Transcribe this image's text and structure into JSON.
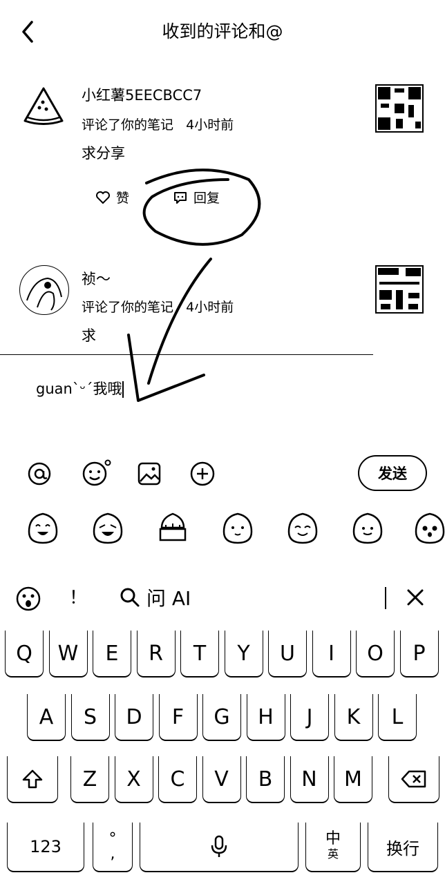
{
  "header": {
    "title": "收到的评论和@"
  },
  "comments": [
    {
      "name": "小红薯5EECBCC7",
      "action": "评论了你的笔记",
      "time": "4小时前",
      "text": "求分享",
      "like_label": "赞",
      "reply_label": "回复"
    },
    {
      "name": "祯～",
      "action": "评论了你的笔记",
      "time": "4小时前",
      "text": "求"
    }
  ],
  "input": {
    "value": "guanˋᵕˊ我哦"
  },
  "toolbar": {
    "send_label": "发送"
  },
  "suggestions": {
    "exclaim": "！",
    "ask_ai": "问 AI"
  },
  "keyboard": {
    "row1": [
      "Q",
      "W",
      "E",
      "R",
      "T",
      "Y",
      "U",
      "I",
      "O",
      "P"
    ],
    "row2": [
      "A",
      "S",
      "D",
      "F",
      "G",
      "H",
      "J",
      "K",
      "L"
    ],
    "row3": [
      "Z",
      "X",
      "C",
      "V",
      "B",
      "N",
      "M"
    ],
    "num_label": "123",
    "punct_top": "°",
    "punct_bottom": ",",
    "lang_top": "中",
    "lang_bottom": "英",
    "enter_label": "换行"
  }
}
